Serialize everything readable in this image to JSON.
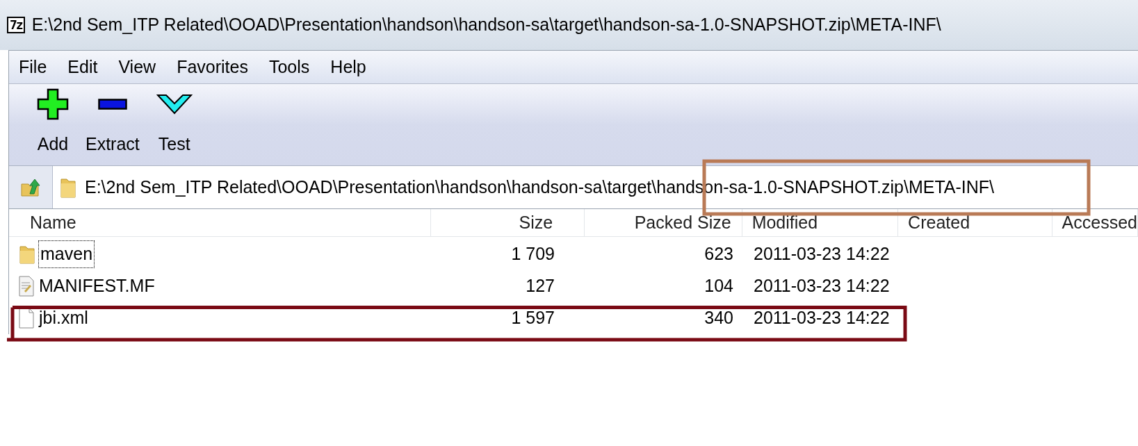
{
  "window": {
    "title": "E:\\2nd Sem_ITP Related\\OOAD\\Presentation\\handson\\handson-sa\\target\\handson-sa-1.0-SNAPSHOT.zip\\META-INF\\",
    "app_icon": "7z"
  },
  "menu": [
    "File",
    "Edit",
    "View",
    "Favorites",
    "Tools",
    "Help"
  ],
  "toolbar": [
    {
      "kind": "add",
      "label": "Add"
    },
    {
      "kind": "extract",
      "label": "Extract"
    },
    {
      "kind": "test",
      "label": "Test"
    }
  ],
  "address": {
    "value": "E:\\2nd Sem_ITP Related\\OOAD\\Presentation\\handson\\handson-sa\\target\\handson-sa-1.0-SNAPSHOT.zip\\META-INF\\"
  },
  "table": {
    "columns": [
      "Name",
      "Size",
      "Packed Size",
      "Modified",
      "Created",
      "Accessed"
    ],
    "rows": [
      {
        "kind": "folder",
        "name": "maven",
        "size": "1 709",
        "packed_size": "623",
        "modified": "2011-03-23 14:22",
        "focused": true
      },
      {
        "kind": "text",
        "name": "MANIFEST.MF",
        "size": "127",
        "packed_size": "104",
        "modified": "2011-03-23 14:22",
        "focused": false
      },
      {
        "kind": "file",
        "name": "jbi.xml",
        "size": "1 597",
        "packed_size": "340",
        "modified": "2011-03-23 14:22",
        "focused": false
      }
    ]
  }
}
